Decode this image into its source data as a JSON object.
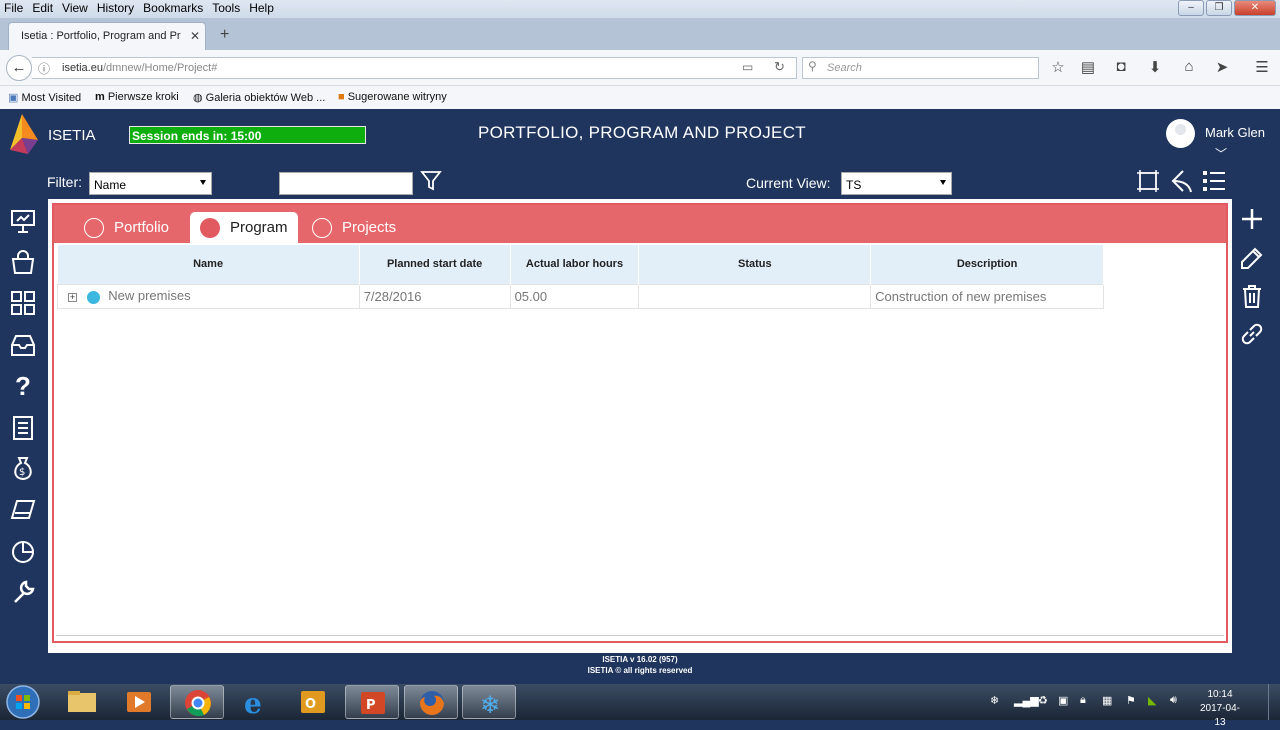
{
  "browser": {
    "menu": [
      "File",
      "Edit",
      "View",
      "History",
      "Bookmarks",
      "Tools",
      "Help"
    ],
    "tab_title": "Isetia : Portfolio, Program and Pr",
    "url_domain": "isetia.eu",
    "url_path": "/dmnew/Home/Project#",
    "search_placeholder": "Search",
    "bookmarks": [
      "Most Visited",
      "Pierwsze kroki",
      "Galeria obiektów Web ...",
      "Sugerowane witryny"
    ]
  },
  "app": {
    "brand": "ISETIA",
    "session": "Session ends in: 15:00",
    "title": "PORTFOLIO, PROGRAM AND PROJECT",
    "user": "Mark Glen",
    "filter_label": "Filter:",
    "filter_value": "Name",
    "current_view_label": "Current View:",
    "current_view_value": "TS",
    "accent": "#e6676b",
    "header_bg": "#1f355e"
  },
  "tabs": [
    {
      "label": "Portfolio",
      "selected": false
    },
    {
      "label": "Program",
      "selected": true
    },
    {
      "label": "Projects",
      "selected": false
    }
  ],
  "grid": {
    "columns": [
      "Name",
      "Planned start date",
      "Actual labor hours",
      "Status",
      "Description"
    ],
    "rows": [
      {
        "name": "New premises",
        "start": "7/28/2016",
        "hours": "05.00",
        "status": "",
        "description": "Construction of new premises"
      }
    ]
  },
  "footer": {
    "version": "ISETIA v 16.02 (957)",
    "copyright": "ISETIA © all rights reserved"
  },
  "taskbar": {
    "time": "10:14",
    "date": "2017-04-13"
  }
}
